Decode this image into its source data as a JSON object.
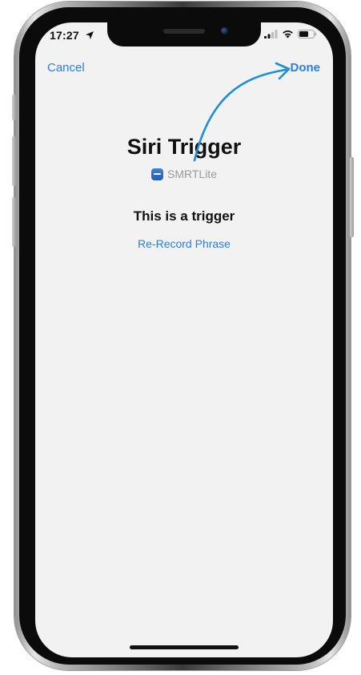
{
  "status_bar": {
    "time": "17:27",
    "location_icon": "location-arrow-icon",
    "signal_icon": "cellular-signal-icon",
    "wifi_icon": "wifi-icon",
    "battery_icon": "battery-icon"
  },
  "nav": {
    "cancel_label": "Cancel",
    "done_label": "Done"
  },
  "shortcut": {
    "title": "Siri Trigger",
    "app_name": "SMRTLite",
    "app_icon": "smrtlite-app-icon",
    "phrase": "This is a trigger",
    "rerecord_label": "Re-Record Phrase"
  },
  "annotation": {
    "icon": "curved-arrow-icon",
    "color": "#1b8fd6",
    "points_to": "done-button"
  },
  "colors": {
    "accent": "#2f7ce0",
    "background": "#f2f2f2",
    "text": "#111111",
    "secondary_text": "#9a9a9a"
  }
}
